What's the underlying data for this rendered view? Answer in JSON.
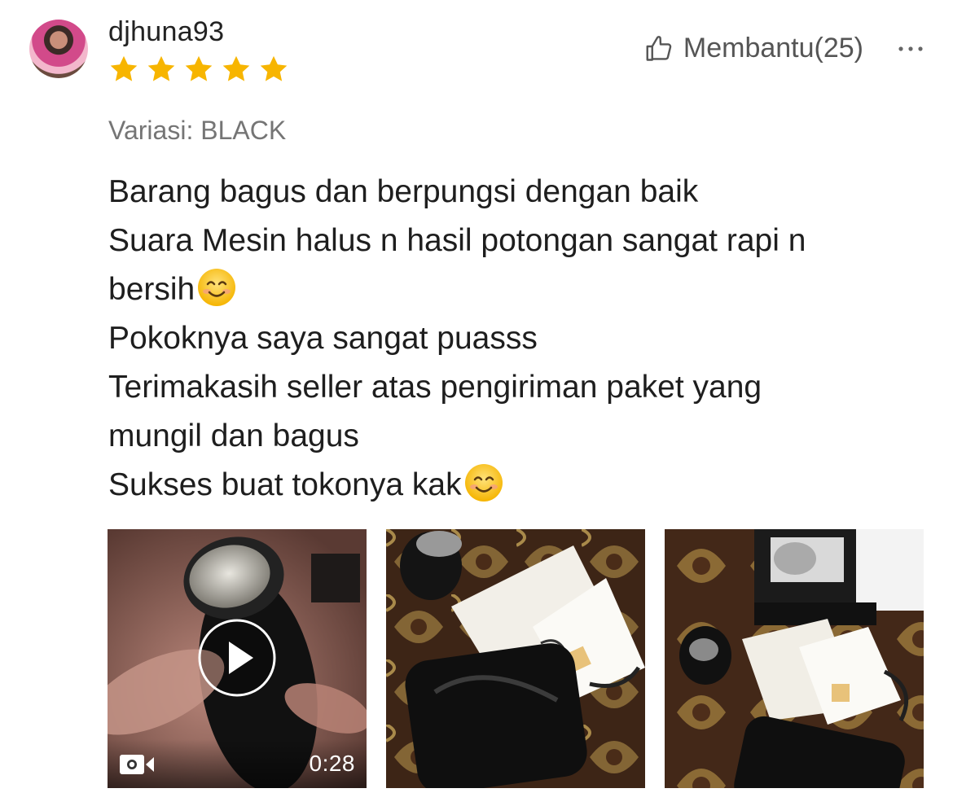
{
  "reviewer": {
    "username": "djhuna93",
    "rating": 5
  },
  "helpful": {
    "label": "Membantu(25)"
  },
  "variation": "Variasi: BLACK",
  "review_lines": [
    "Barang bagus dan berpungsi dengan baik",
    "Suara Mesin halus n hasil potongan sangat rapi n",
    "bersih",
    "Pokoknya saya sangat puasss",
    "Terimakasih seller atas pengiriman paket yang",
    "mungil dan bagus",
    "Sukses buat tokonya kak"
  ],
  "media": {
    "video_duration": "0:28"
  },
  "icons": {
    "star": "star-icon",
    "thumb": "thumbs-up-icon",
    "more": "more-dots-icon",
    "play": "play-icon",
    "video": "video-camera-icon",
    "emoji": "smiling-face-icon"
  },
  "colors": {
    "star": "#f7b500",
    "muted_text": "#757575",
    "body_text": "#1e1e1e"
  }
}
